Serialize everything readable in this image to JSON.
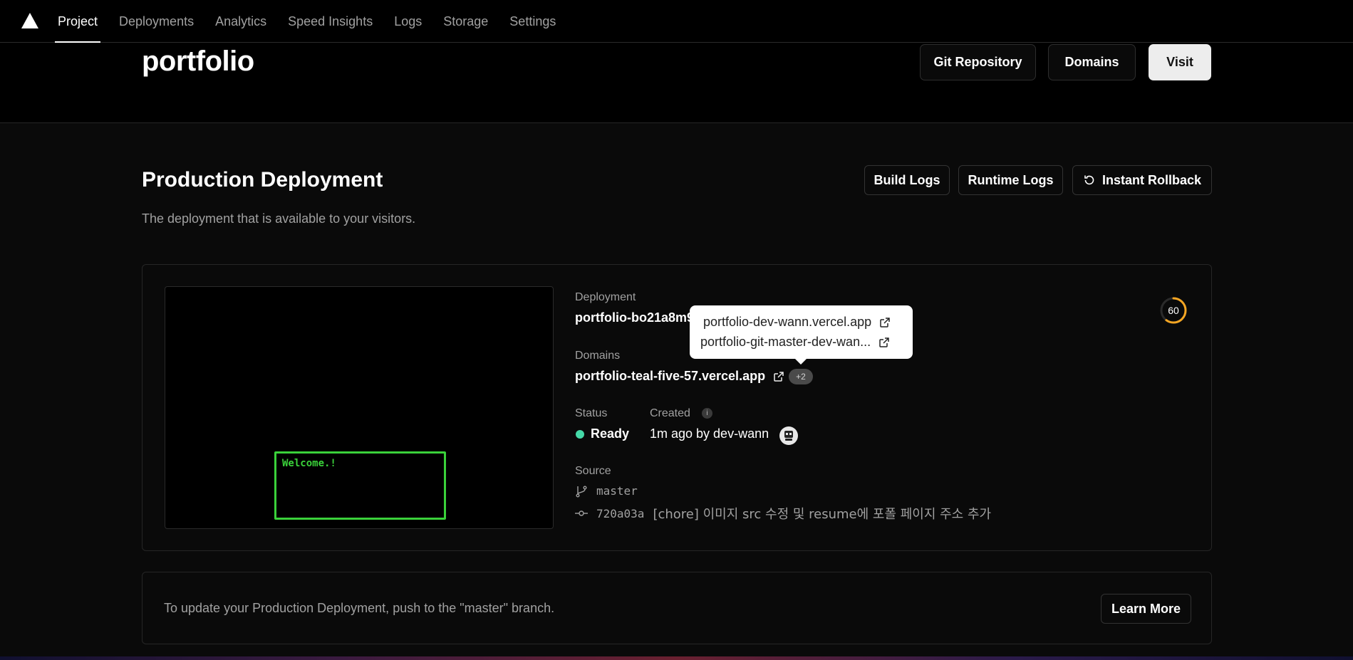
{
  "nav": {
    "tabs": [
      {
        "label": "Project",
        "active": true
      },
      {
        "label": "Deployments",
        "active": false
      },
      {
        "label": "Analytics",
        "active": false
      },
      {
        "label": "Speed Insights",
        "active": false
      },
      {
        "label": "Logs",
        "active": false
      },
      {
        "label": "Storage",
        "active": false
      },
      {
        "label": "Settings",
        "active": false
      }
    ]
  },
  "header": {
    "title": "portfolio",
    "git_label": "Git Repository",
    "domains_label": "Domains",
    "visit_label": "Visit"
  },
  "section": {
    "title": "Production Deployment",
    "subtitle": "The deployment that is available to your visitors.",
    "build_logs": "Build Logs",
    "runtime_logs": "Runtime Logs",
    "rollback": "Instant Rollback"
  },
  "preview": {
    "text": "Welcome.!"
  },
  "deployment": {
    "deployment_label": "Deployment",
    "deployment_value": "portfolio-bo21a8m9",
    "domains_label": "Domains",
    "domain_value": "portfolio-teal-five-57.vercel.app",
    "extra_domains": "+2",
    "status_label": "Status",
    "status_value": "Ready",
    "status_color": "#45d9a8",
    "created_label": "Created",
    "created_value": "1m ago by dev-wann",
    "source_label": "Source",
    "branch": "master",
    "commit_hash": "720a03a",
    "commit_message": "[chore] 이미지 src 수정 및 resume에 포폴 페이지 주소 추가",
    "score": "60",
    "score_fraction": 0.6,
    "score_color": "#f5a623"
  },
  "popover": {
    "links": [
      "portfolio-dev-wann.vercel.app",
      "portfolio-git-master-dev-wan..."
    ]
  },
  "note": {
    "text": "To update your Production Deployment, push to the \"master\" branch.",
    "learn_more": "Learn More"
  }
}
